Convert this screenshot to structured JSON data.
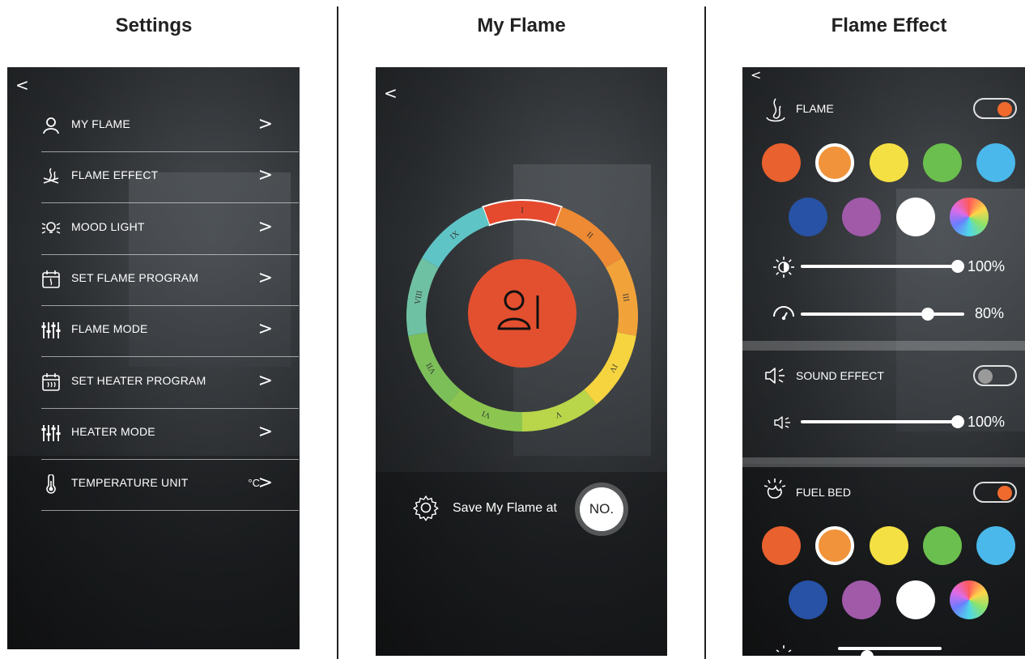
{
  "columns": {
    "settings_title": "Settings",
    "myflame_title": "My Flame",
    "effect_title": "Flame Effect"
  },
  "settings": {
    "back": "<",
    "items": [
      {
        "label": "MY FLAME",
        "icon": "person-icon"
      },
      {
        "label": "FLAME EFFECT",
        "icon": "campfire-icon"
      },
      {
        "label": "MOOD LIGHT",
        "icon": "bulb-icon"
      },
      {
        "label": "SET FLAME PROGRAM",
        "icon": "calendar-flame-icon"
      },
      {
        "label": "FLAME MODE",
        "icon": "sliders-icon"
      },
      {
        "label": "SET HEATER PROGRAM",
        "icon": "calendar-heat-icon"
      },
      {
        "label": "HEATER MODE",
        "icon": "sliders-icon"
      },
      {
        "label": "TEMPERATURE UNIT",
        "icon": "thermometer-icon",
        "value": "°C"
      }
    ],
    "chevron": ">"
  },
  "myflame": {
    "back": "<",
    "presets": [
      "I",
      "II",
      "III",
      "IV",
      "V",
      "VI",
      "VII",
      "VIII",
      "IX"
    ],
    "preset_colors": [
      "#e64a2e",
      "#ee8a33",
      "#f1a33a",
      "#f6d440",
      "#b9d54a",
      "#8cc651",
      "#7cbf59",
      "#6fc1a3",
      "#5fc4c6"
    ],
    "selected_preset": "I",
    "save_label": "Save My Flame at",
    "save_button": "NO."
  },
  "effect": {
    "back": "<",
    "flame": {
      "label": "FLAME",
      "toggle_on": true,
      "colors": [
        "#e8612f",
        "#f0933a",
        "#f4e043",
        "#6bbf4e",
        "#4ab8ea",
        "#2752a5",
        "#a05aa8",
        "#ffffff",
        "rainbow"
      ],
      "selected_index": 1,
      "brightness": "100%",
      "brightness_value": 1.0,
      "speed": "80%",
      "speed_value": 0.8
    },
    "sound": {
      "label": "SOUND EFFECT",
      "toggle_on": false,
      "volume": "100%",
      "volume_value": 1.0
    },
    "fuel": {
      "label": "FUEL BED",
      "toggle_on": true,
      "colors": [
        "#e8612f",
        "#f0933a",
        "#f4e043",
        "#6bbf4e",
        "#4ab8ea",
        "#2752a5",
        "#a05aa8",
        "#ffffff",
        "rainbow"
      ],
      "selected_index": 1
    },
    "accent": "#ef6a2c"
  }
}
